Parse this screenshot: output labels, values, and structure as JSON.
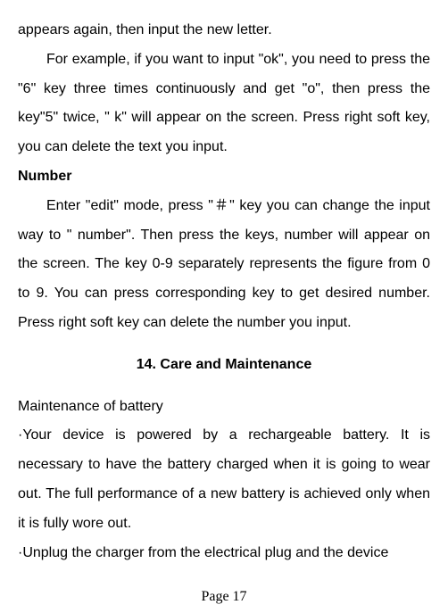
{
  "paragraphs": {
    "p1": "appears again, then input the new letter.",
    "p2": "For example, if you want to input \"ok\", you need to press the \"6\" key three times continuously and get \"o\", then press the key\"5\" twice, \" k\" will appear on the screen. Press right soft key, you can delete the text you input.",
    "heading_number": "Number",
    "p3": "Enter \"edit\" mode, press \"＃\" key you can change the input way to \" number\". Then press the keys, number will appear on the screen. The key 0-9 separately represents the figure from 0 to 9. You can press corresponding key to get desired number. Press right soft key can delete the number you input.",
    "section_heading": "14.    Care and Maintenance",
    "p4": "Maintenance of battery",
    "p5": "·Your device is powered by a rechargeable battery. It is necessary to have the battery charged when it is going to wear out. The full performance of a new battery is achieved only when it is fully wore out.",
    "p6": "·Unplug the charger from the electrical plug and the device"
  },
  "page_number": "Page 17"
}
